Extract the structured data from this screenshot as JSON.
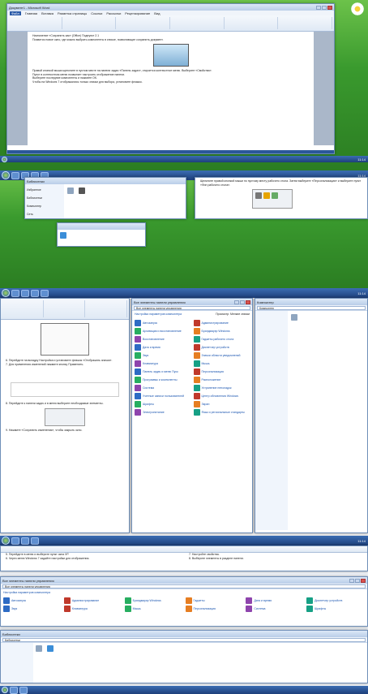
{
  "frame1": {
    "word_title": "Документ1 - Microsoft Word",
    "tabs": [
      "Файл",
      "Главная",
      "Вставка",
      "Разметка страницы",
      "Ссылки",
      "Рассылки",
      "Рецензирование",
      "Вид"
    ],
    "doc_paragraphs": [
      "Назначение «Сохранить как» (Office) Подпункт 2.1",
      "Появится новое окно, где можно выбрать компоненты в списке, позволяющие сохранить документ.",
      "Правой кнопкой мыши щелкните в пустом месте на панели задач «Панель задач», откроется контекстное меню. Выберите «Свойства».",
      "Пункт в контекстном меню позволяет настроить отображение панели.",
      "Выберите последние компоненты и нажмите ОК.",
      "Чтобы на Windows 7 отображались только значки для выбора, установите флажок."
    ],
    "tray_time": "11:14"
  },
  "frame2": {
    "explorer_title": "Библиотеки",
    "right_text": "Щелкните правой кнопкой мыши по пустому месту рабочего стола. Затем выберите «Персонализация» и выберите пункт «Фон рабочего стола».",
    "folders": [
      "Избранное",
      "Библиотеки",
      "Компьютер",
      "Сеть"
    ],
    "tray_time": "11:14"
  },
  "frame3": {
    "cp_title": "Все элементы панели управления",
    "cp_heading": "Настройка параметров компьютера",
    "cp_view": "Просмотр: Мелкие значки",
    "cp_items": [
      "Автозапуск",
      "Администрирование",
      "Архивация и восстановление",
      "Брандмауэр Windows",
      "Восстановление",
      "Гаджеты рабочего стола",
      "Дата и время",
      "Диспетчер устройств",
      "Звук",
      "Значки области уведомлений",
      "Клавиатура",
      "Мышь",
      "Панель задач и меню Пуск",
      "Персонализация",
      "Программы и компоненты",
      "Расположение",
      "Система",
      "Устранение неполадок",
      "Учетные записи пользователей",
      "Центр обновления Windows",
      "Шрифты",
      "Экран",
      "Электропитание",
      "Язык и региональные стандарты"
    ],
    "doc_steps": [
      "6. Перейдите на вкладку Настройка и установите флажок «Отображать значки».",
      "7. Для применения изменений нажмите кнопку Применить.",
      "8. Перейдите к панели задач и в меню выберите необходимые элементы.",
      "9. Нажмите «Сохранить изменения», чтобы закрыть окно."
    ],
    "explorer_title": "Компьютер",
    "tray_time": "11:14"
  },
  "frame4": {
    "doc_steps": [
      "5. Перейдите в меню и выберите пункт окна XP.",
      "6. Через меню Windows 7 задайте настройки для отображения.",
      "7. Настройте свойства.",
      "8. Выберите элементы в разделе панели."
    ],
    "cp_title": "Все элементы панели управления",
    "cp_heading": "Настройка параметров компьютера",
    "cp_items": [
      "Автозапуск",
      "Администрирование",
      "Брандмауэр Windows",
      "Гаджеты",
      "Дата и время",
      "Диспетчер устройств",
      "Звук",
      "Клавиатура",
      "Мышь",
      "Персонализация",
      "Система",
      "Шрифты"
    ],
    "explorer_title": "Библиотеки",
    "tray_time": "11:14"
  }
}
